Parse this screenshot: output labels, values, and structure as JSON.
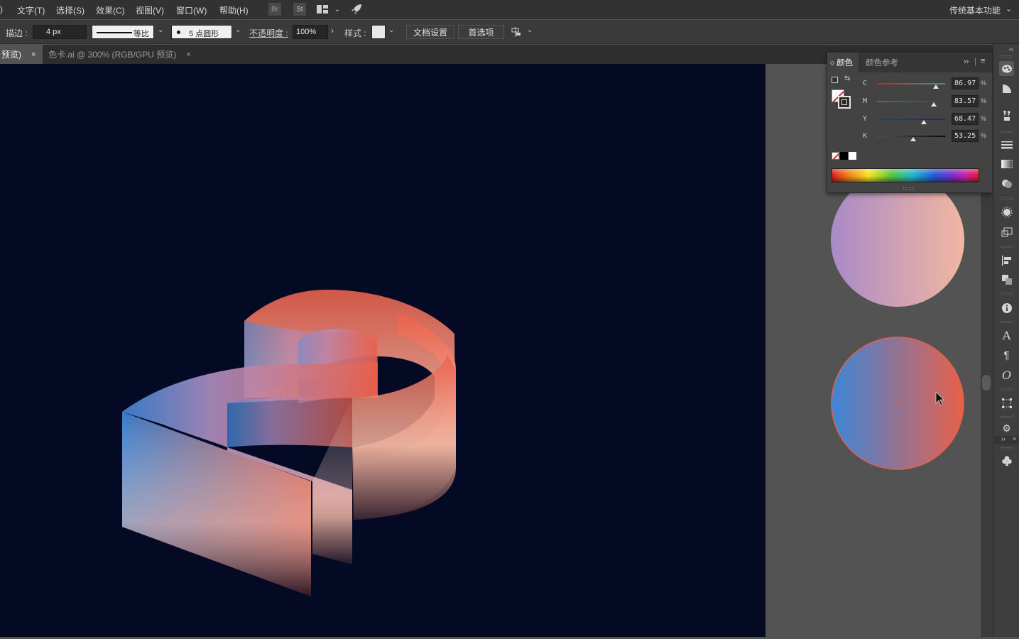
{
  "menubar": {
    "items": [
      "文字(T)",
      "选择(S)",
      "效果(C)",
      "视图(V)",
      "窗口(W)",
      "帮助(H)"
    ],
    "left_fragment": ")",
    "bridge_label": "Br",
    "stock_label": "St",
    "workspace": "传统基本功能"
  },
  "controlbar": {
    "stroke_label": "描边 :",
    "stroke_value": "4 px",
    "profile_label": "等比",
    "brush_label": "5 点圆形",
    "opacity_label": "不透明度 :",
    "opacity_value": "100%",
    "style_label": "样式 :",
    "doc_setup": "文档设置",
    "preferences": "首选项"
  },
  "tabs": [
    {
      "label": "预览)",
      "active": true
    },
    {
      "label": "色卡.ai @ 300% (RGB/GPU 预览)",
      "active": false
    }
  ],
  "color_panel": {
    "tab_color": "颜色",
    "tab_guide": "颜色参考",
    "sliders": [
      {
        "label": "C",
        "value": "86.97",
        "fraction": 0.8697,
        "track": "linear-gradient(90deg,#c8262e,#4b8f8a)"
      },
      {
        "label": "M",
        "value": "83.57",
        "fraction": 0.8357,
        "track": "linear-gradient(90deg,#1f8a6a,#4c3a58)"
      },
      {
        "label": "Y",
        "value": "68.47",
        "fraction": 0.6847,
        "track": "linear-gradient(90deg,#213c8e,#2a2a52)"
      },
      {
        "label": "K",
        "value": "53.25",
        "fraction": 0.5325,
        "track": "linear-gradient(90deg,#4a5064,#0a0a10)"
      }
    ],
    "pct": "%"
  },
  "swatches": {
    "top_circle": {
      "from": "#a88ac6",
      "to": "#f2b6a2"
    },
    "bottom_circle": {
      "from": "#3d86d8",
      "to": "#e8604b"
    }
  },
  "colors": {
    "canvas": "#050a24",
    "accent_red": "#e8604b",
    "accent_blue": "#3d86d8"
  }
}
